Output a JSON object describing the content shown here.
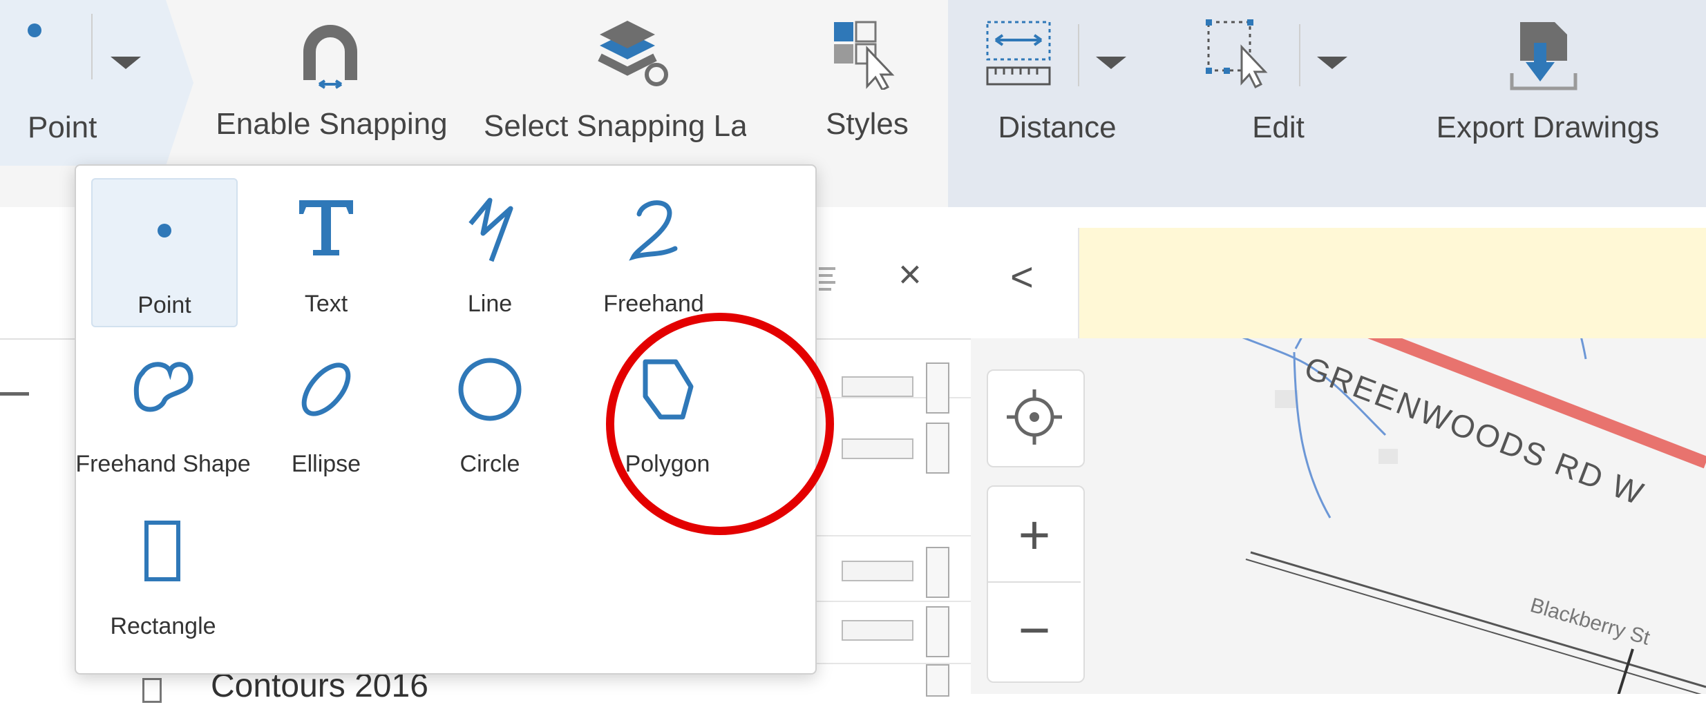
{
  "ribbon": {
    "point_label": "Point",
    "enable_snapping_label": "Enable Snapping",
    "select_snapping_label": "Select Snapping Layers",
    "styles_label": "Styles",
    "distance_label": "Distance",
    "edit_label": "Edit",
    "export_label": "Export Drawings"
  },
  "draw_menu": {
    "tools": [
      {
        "label": "Point",
        "icon": "point-icon",
        "selected": true
      },
      {
        "label": "Text",
        "icon": "text-icon"
      },
      {
        "label": "Line",
        "icon": "line-icon"
      },
      {
        "label": "Freehand",
        "icon": "freehand-icon"
      },
      {
        "label": "Freehand Shape",
        "icon": "freehand-shape-icon"
      },
      {
        "label": "Ellipse",
        "icon": "ellipse-icon"
      },
      {
        "label": "Circle",
        "icon": "circle-icon"
      },
      {
        "label": "Polygon",
        "icon": "polygon-icon"
      },
      {
        "label": "Rectangle",
        "icon": "rectangle-icon"
      }
    ]
  },
  "layers": {
    "close_glyph": "×",
    "list_label": "Contours 2016"
  },
  "map": {
    "collapse_glyph": "<",
    "zoom_in_glyph": "+",
    "zoom_out_glyph": "−",
    "street_1": "GREENWOODS RD W",
    "street_2": "Blackberry St"
  },
  "colors": {
    "accent": "#2f78b8",
    "highlight": "#e30000",
    "road": "#e8736e"
  }
}
